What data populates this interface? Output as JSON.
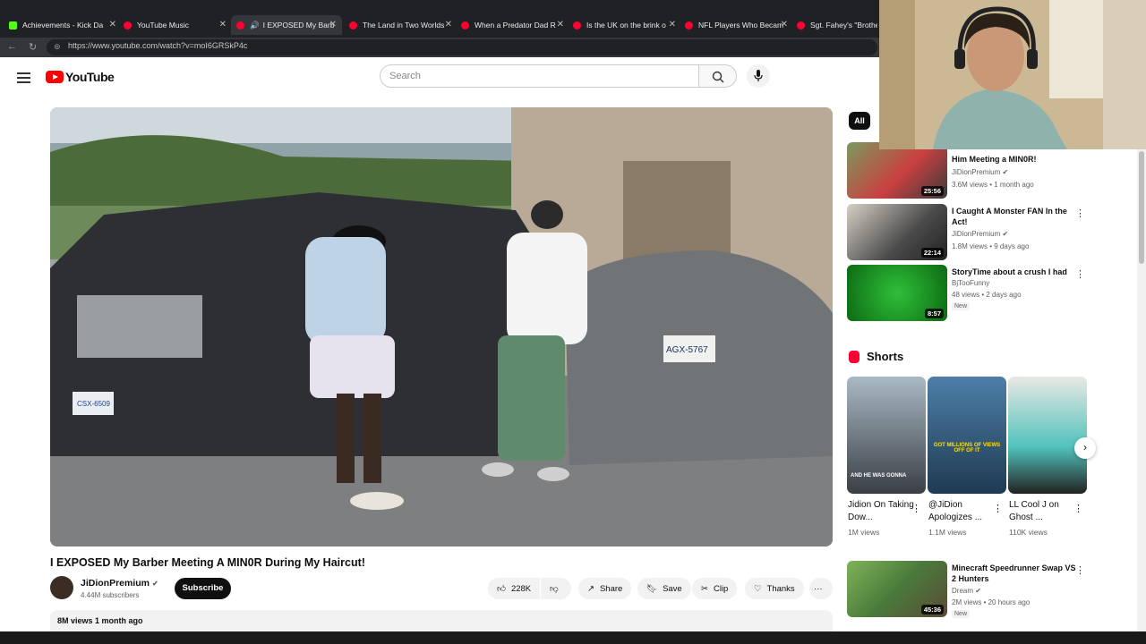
{
  "browser": {
    "tabs": [
      {
        "label": "Achievements - Kick Da",
        "color": "#53fc18"
      },
      {
        "label": "YouTube Music",
        "color": "#ff0033"
      },
      {
        "label": "I EXPOSED My Barb",
        "color": "#ff0033"
      },
      {
        "label": "The Land in Two Worlds",
        "color": "#ff0033"
      },
      {
        "label": "When a Predator Dad R",
        "color": "#ff0033"
      },
      {
        "label": "Is the UK on the brink o",
        "color": "#ff0033"
      },
      {
        "label": "NFL Players Who Becam",
        "color": "#ff0033"
      },
      {
        "label": "Sgt. Fahey's \"Brothers",
        "color": "#ff0033"
      }
    ],
    "url": "https://www.youtube.com/watch?v=moI6GRSkP4c"
  },
  "header": {
    "logo_text": "YouTube",
    "search_placeholder": "Search"
  },
  "video": {
    "title": "I EXPOSED My Barber Meeting A MIN0R During My Haircut!",
    "channel": "JiDionPremium",
    "subscribers": "4.44M subscribers",
    "subscribe_label": "Subscribe",
    "likes": "228K",
    "share_label": "Share",
    "save_label": "Save",
    "clip_label": "Clip",
    "thanks_label": "Thanks",
    "more_label": "···",
    "views_date": "8M views  1 month ago",
    "plate_truck": "CSX-6509",
    "plate_car": "AGX-5767"
  },
  "sidebar": {
    "filter_chip": "All",
    "videos": [
      {
        "title": "Him Meeting a MIN0R!",
        "channel": "JiDionPremium",
        "meta": "3.6M views • 1 month ago",
        "duration": "25:56",
        "verified": true,
        "new": ""
      },
      {
        "title": "I Caught A Monster FAN In the Act!",
        "channel": "JiDionPremium",
        "meta": "1.8M views • 9 days ago",
        "duration": "22:14",
        "verified": true,
        "new": ""
      },
      {
        "title": "StoryTime about a crush I had",
        "channel": "BjTooFunny",
        "meta": "48 views • 2 days ago",
        "duration": "8:57",
        "verified": false,
        "new": "New"
      },
      {
        "title": "Minecraft Speedrunner Swap VS 2 Hunters",
        "channel": "Dream",
        "meta": "2M views • 20 hours ago",
        "duration": "45:36",
        "verified": true,
        "new": "New"
      }
    ],
    "shorts_title": "Shorts",
    "shorts": [
      {
        "title": "Jidion On Taking Dow...",
        "views": "1M views",
        "caption": "AND HE WAS GONNA"
      },
      {
        "title": "@JiDion Apologizes ...",
        "views": "1.1M views",
        "caption": "GOT MILLIONS OF VIEWS OFF OF IT"
      },
      {
        "title": "LL Cool J on Ghost ...",
        "views": "110K views",
        "caption": ""
      }
    ]
  }
}
